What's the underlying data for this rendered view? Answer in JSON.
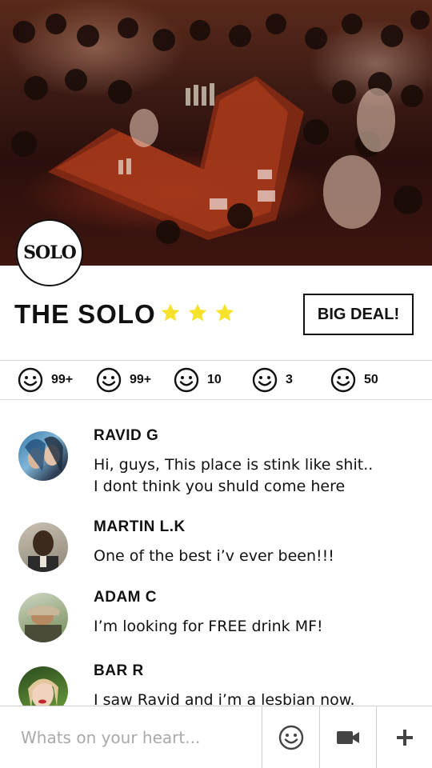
{
  "venue": {
    "name": "THE SOLO",
    "rating": 3,
    "max_rating": 3,
    "logo_text": "SOLO",
    "deal_label": "BIG DEAL!"
  },
  "reactions": [
    {
      "icon": "smiley-icon",
      "count": "99+"
    },
    {
      "icon": "smiley-icon",
      "count": "99+"
    },
    {
      "icon": "smiley-icon",
      "count": "10"
    },
    {
      "icon": "smiley-icon",
      "count": "3"
    },
    {
      "icon": "smiley-icon",
      "count": "50"
    }
  ],
  "comments": [
    {
      "author": "RAVID G",
      "text": "Hi, guys, This place is stink like shit..\nI dont think you shuld come here"
    },
    {
      "author": "MARTIN L.K",
      "text": "One of the best i’v ever been!!!"
    },
    {
      "author": "ADAM C",
      "text": "I’m looking for FREE drink MF!"
    },
    {
      "author": "BAR R",
      "text": "I saw Ravid and i’m a lesbian now."
    }
  ],
  "composer": {
    "placeholder": "Whats on your heart...",
    "emoji_icon": "smiley-icon",
    "video_icon": "video-camera-icon",
    "add_icon": "plus-icon"
  },
  "colors": {
    "star": "#f7e22b",
    "text": "#111111",
    "divider": "#d6d6d6",
    "placeholder": "#a9a9a9"
  }
}
